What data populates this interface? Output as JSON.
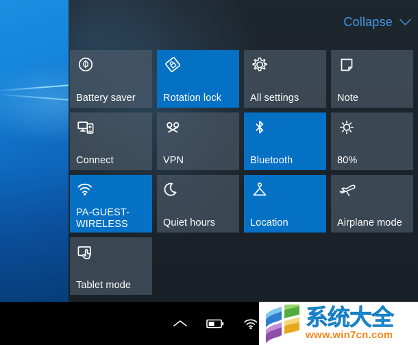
{
  "desktop": {
    "wallpaper_color": "#0f6dc4"
  },
  "action_center": {
    "collapse_label": "Collapse",
    "accent_color": "#0571c5",
    "tile_off_color": "#4f5e6c",
    "link_color": "#3d9ae8",
    "tiles": [
      {
        "label": "Battery saver",
        "icon": "battery-saver-icon",
        "state": "off"
      },
      {
        "label": "Rotation lock",
        "icon": "rotation-lock-icon",
        "state": "on"
      },
      {
        "label": "All settings",
        "icon": "gear-icon",
        "state": "off"
      },
      {
        "label": "Note",
        "icon": "note-icon",
        "state": "off"
      },
      {
        "label": "Connect",
        "icon": "connect-icon",
        "state": "off"
      },
      {
        "label": "VPN",
        "icon": "vpn-icon",
        "state": "off"
      },
      {
        "label": "Bluetooth",
        "icon": "bluetooth-icon",
        "state": "on"
      },
      {
        "label": "80%",
        "icon": "brightness-icon",
        "state": "off"
      },
      {
        "label": "PA-GUEST-\nWIRELESS",
        "icon": "wifi-icon",
        "state": "on"
      },
      {
        "label": "Quiet hours",
        "icon": "moon-icon",
        "state": "off"
      },
      {
        "label": "Location",
        "icon": "location-icon",
        "state": "on"
      },
      {
        "label": "Airplane mode",
        "icon": "airplane-icon",
        "state": "off"
      },
      {
        "label": "Tablet mode",
        "icon": "tablet-mode-icon",
        "state": "off"
      },
      {
        "label": "",
        "icon": "",
        "state": "empty"
      },
      {
        "label": "",
        "icon": "",
        "state": "empty"
      },
      {
        "label": "",
        "icon": "",
        "state": "empty"
      }
    ]
  },
  "taskbar": {
    "tray_icons": [
      "show-hidden-icons-chevron",
      "battery-icon",
      "wifi-icon"
    ]
  },
  "watermark": {
    "site_name": "系统大全",
    "url": "www.win7cn.com"
  }
}
